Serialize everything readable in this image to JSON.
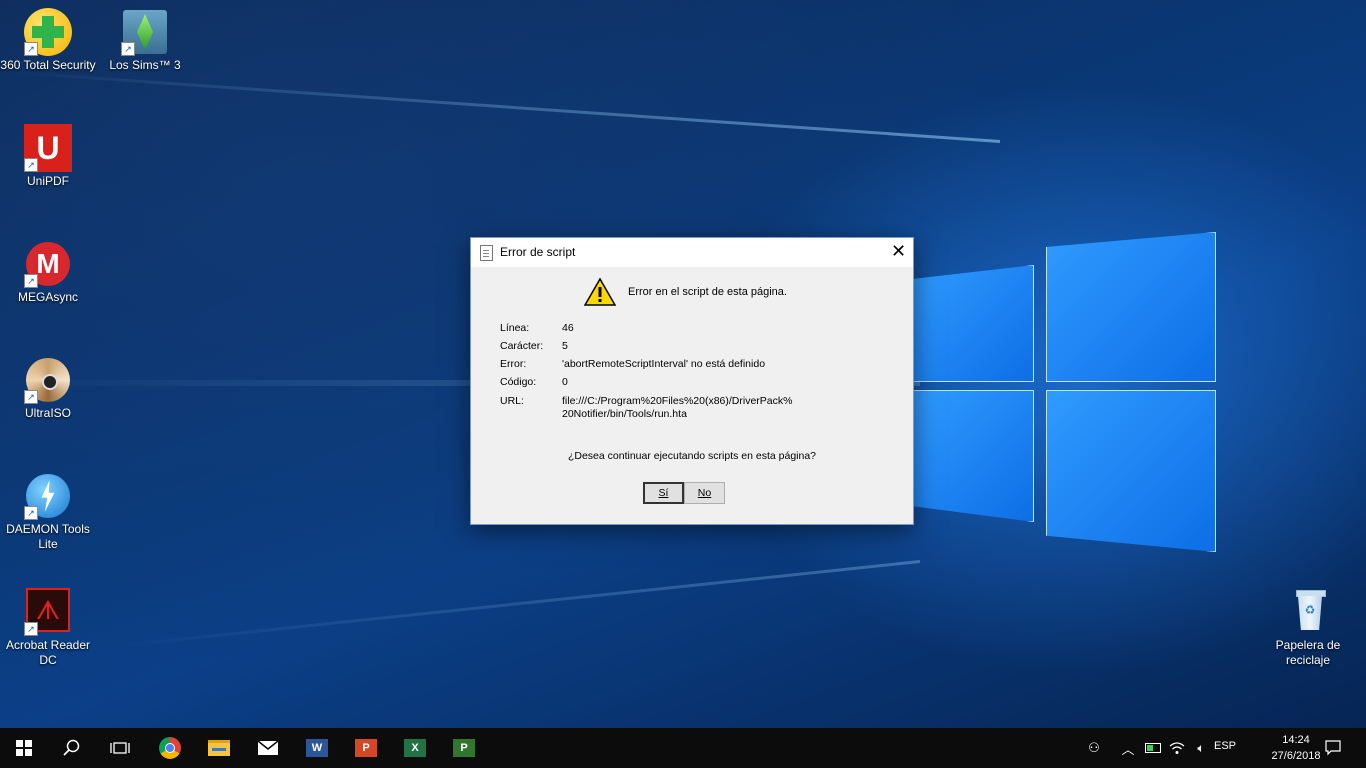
{
  "desktop": {
    "icons": [
      {
        "label": "360 Total Security",
        "icon": "360-total-security-icon"
      },
      {
        "label": "Los Sims™ 3",
        "icon": "sims3-icon"
      },
      {
        "label": "UniPDF",
        "icon": "unipdf-icon"
      },
      {
        "label": "MEGAsync",
        "icon": "megasync-icon"
      },
      {
        "label": "UltraISO",
        "icon": "ultraiso-icon"
      },
      {
        "label": "DAEMON Tools Lite",
        "icon": "daemon-tools-icon"
      },
      {
        "label": "Acrobat Reader DC",
        "icon": "acrobat-reader-icon"
      },
      {
        "label": "Papelera de reciclaje",
        "icon": "recycle-bin-icon"
      }
    ]
  },
  "dialog": {
    "title": "Error de script",
    "message": "Error en el script de esta página.",
    "fields": [
      {
        "key": "Línea:",
        "value": "46"
      },
      {
        "key": "Carácter:",
        "value": "5"
      },
      {
        "key": "Error:",
        "value": "'abortRemoteScriptInterval' no está definido"
      },
      {
        "key": "Código:",
        "value": "0"
      },
      {
        "key": "URL:",
        "value": "file:///C:/Program%20Files%20(x86)/DriverPack%\n20Notifier/bin/Tools/run.hta"
      }
    ],
    "question": "¿Desea continuar ejecutando scripts en esta página?",
    "yes_label": "Sí",
    "no_label": "No"
  },
  "taskbar": {
    "pinned": [
      "start-icon",
      "search-icon",
      "task-view-icon",
      "chrome-icon",
      "file-explorer-icon",
      "mail-icon",
      "word-icon",
      "powerpoint-icon",
      "excel-icon",
      "project-icon"
    ],
    "language": "ESP",
    "time": "14:24",
    "date": "27/6/2018"
  },
  "colors": {
    "accent": "#0e6ee6",
    "taskbar": "#0c0c0c",
    "dialog_bg": "#f0f0f0"
  }
}
